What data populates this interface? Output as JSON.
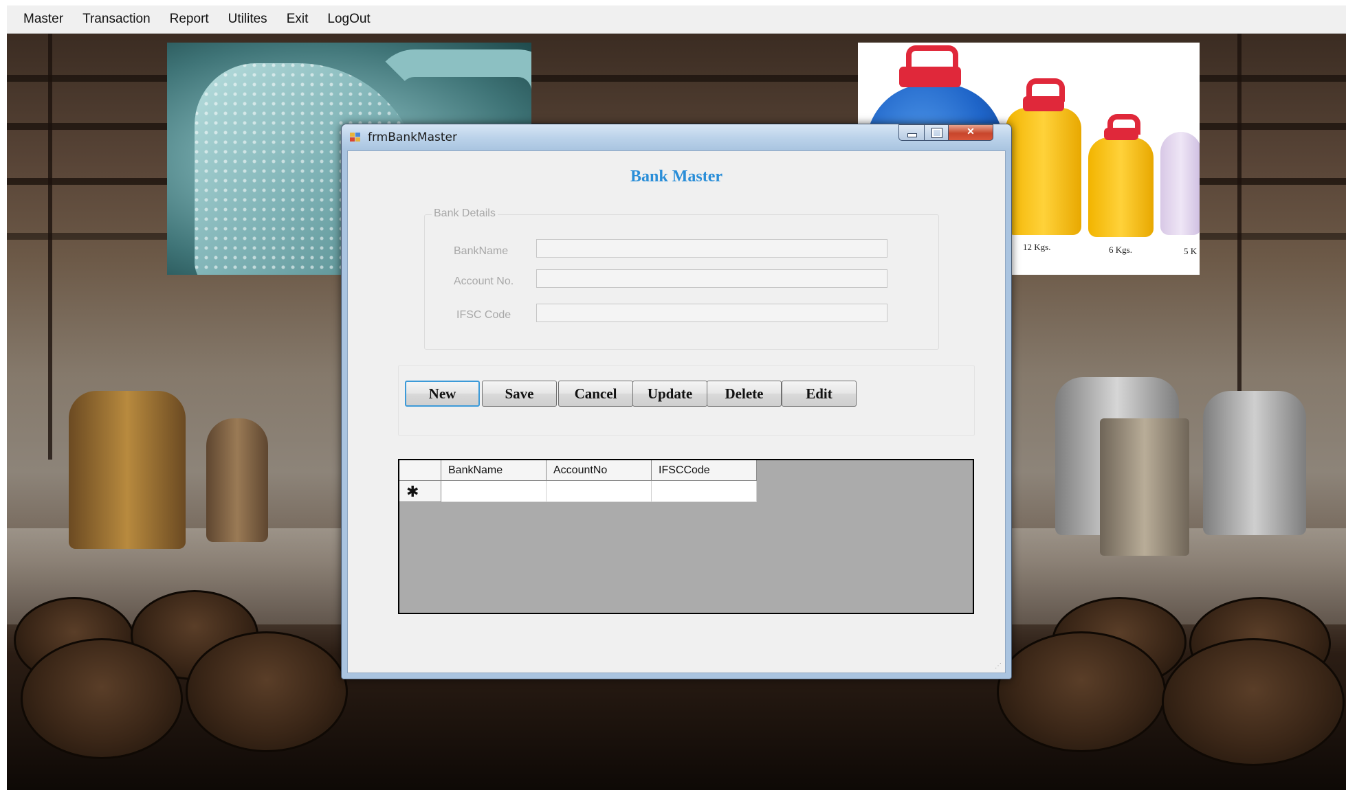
{
  "menu": {
    "items": [
      "Master",
      "Transaction",
      "Report",
      "Utilites",
      "Exit",
      "LogOut"
    ]
  },
  "background": {
    "jar_labels": [
      "12 Kgs.",
      "6 Kgs.",
      "5 K"
    ]
  },
  "window": {
    "title": "frmBankMaster",
    "form_title": "Bank Master",
    "group": {
      "legend": "Bank Details",
      "fields": [
        {
          "label": "BankName",
          "value": ""
        },
        {
          "label": "Account No.",
          "value": ""
        },
        {
          "label": "IFSC Code",
          "value": ""
        }
      ]
    },
    "buttons": [
      "New",
      "Save",
      "Cancel",
      "Update",
      "Delete",
      "Edit"
    ],
    "grid": {
      "columns": [
        "BankName",
        "AccountNo",
        "IFSCCode"
      ],
      "new_row_marker": "✱"
    }
  },
  "colors": {
    "title_accent": "#2a8ed8",
    "default_button_border": "#3c9ad8",
    "grid_background": "#ababab"
  }
}
